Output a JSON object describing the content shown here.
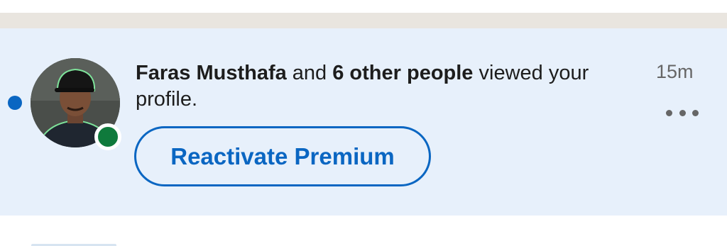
{
  "notification": {
    "actor_name": "Faras Musthafa",
    "connector": " and ",
    "others": "6 other people",
    "action": " viewed your profile.",
    "timestamp": "15m",
    "cta_label": "Reactivate Premium",
    "more_icon": "more-horizontal-icon",
    "unread": true,
    "presence": "online"
  },
  "colors": {
    "accent": "#0a66c2",
    "unread_background": "#e7f0fb",
    "presence_green": "#0f7a3c",
    "separator": "#e9e5df"
  }
}
